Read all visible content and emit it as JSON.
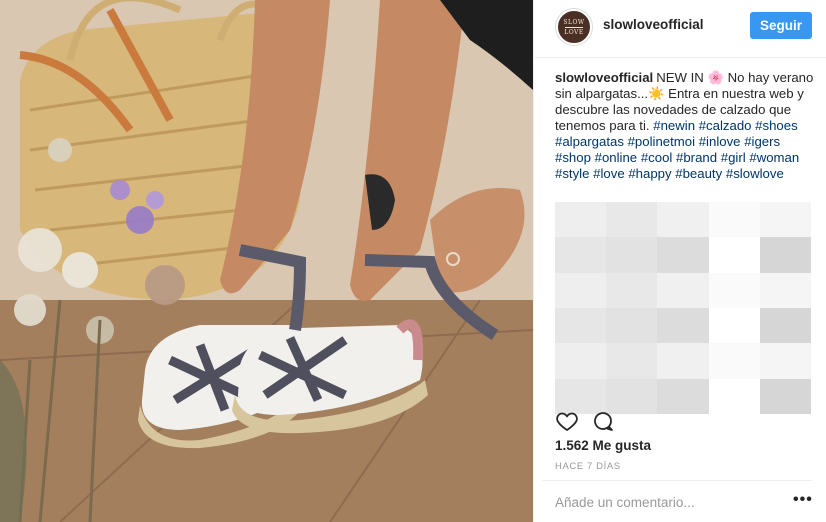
{
  "post": {
    "username": "slowloveofficial",
    "follow_label": "Seguir",
    "avatar_top": "SLOW",
    "avatar_bottom": "LOVE"
  },
  "caption": {
    "username": "slowloveofficial",
    "text_part1": "NEW IN 🌸 No hay verano sin alpargatas...☀️ Entra en nuestra web y descubre las novedades de calzado que tenemos para ti.",
    "hashtags": [
      "#newin",
      "#calzado",
      "#shoes",
      "#alpargatas",
      "#polinetmoi",
      "#inlove",
      "#igers",
      "#shop",
      "#online",
      "#cool",
      "#brand",
      "#girl",
      "#woman",
      "#style",
      "#love",
      "#happy",
      "#beauty",
      "#slowlove"
    ]
  },
  "engagement": {
    "likes": "1.562 Me gusta",
    "time": "HACE 7 DÍAS"
  },
  "comment_box": {
    "placeholder": "Añade un comentario...",
    "more": "•••"
  },
  "icons": {
    "like": "heart-icon",
    "comment": "comment-icon",
    "more": "more-options-icon"
  },
  "colors": {
    "follow_button": "#3897f0",
    "hashtag": "#003569",
    "muted": "#999999"
  }
}
